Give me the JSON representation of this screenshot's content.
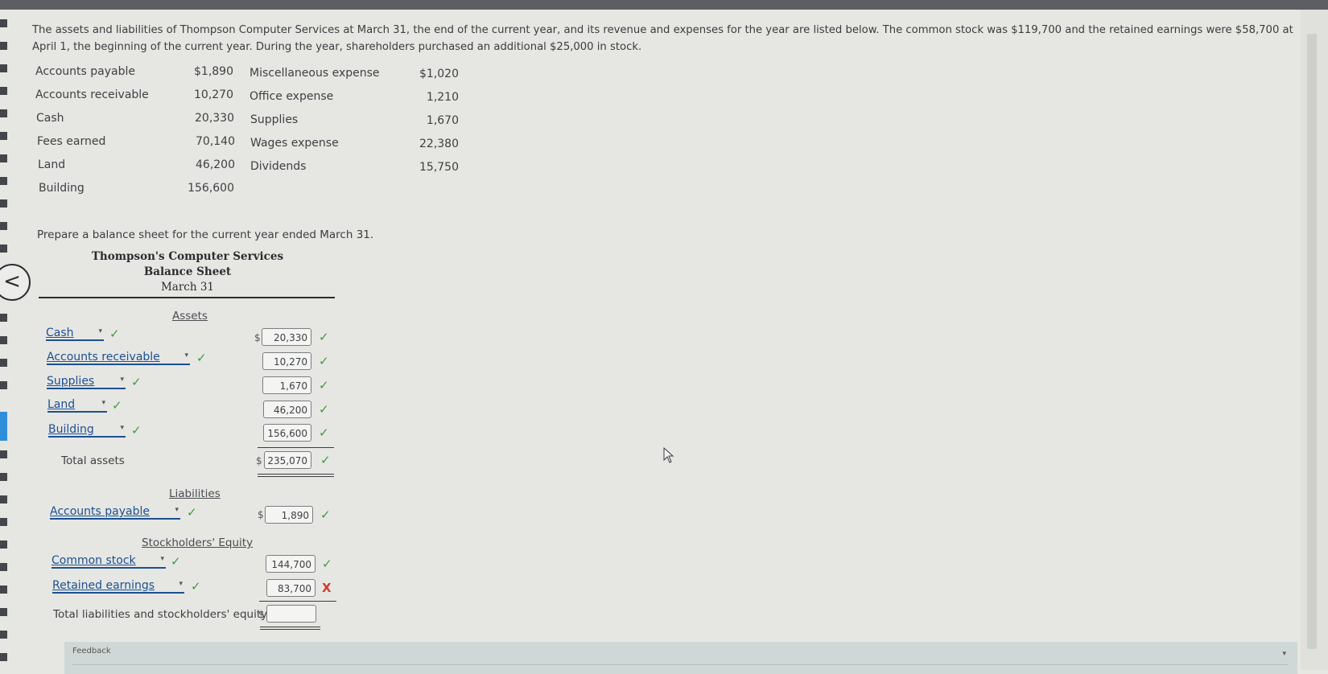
{
  "intro_text": "The assets and liabilities of Thompson Computer Services at March 31, the end of the current year, and its revenue and expenses for the year are listed below. The common stock was $119,700 and the retained earnings were $58,700 at April 1, the beginning of the current year. During the year, shareholders purchased an additional $25,000 in stock.",
  "data_list": {
    "left": [
      {
        "label": "Accounts payable",
        "value": "$1,890"
      },
      {
        "label": "Accounts receivable",
        "value": "10,270"
      },
      {
        "label": "Cash",
        "value": "20,330"
      },
      {
        "label": "Fees earned",
        "value": "70,140"
      },
      {
        "label": "Land",
        "value": "46,200"
      },
      {
        "label": "Building",
        "value": "156,600"
      }
    ],
    "right": [
      {
        "label": "Miscellaneous expense",
        "value": "$1,020"
      },
      {
        "label": "Office expense",
        "value": "1,210"
      },
      {
        "label": "Supplies",
        "value": "1,670"
      },
      {
        "label": "Wages expense",
        "value": "22,380"
      },
      {
        "label": "Dividends",
        "value": "15,750"
      }
    ]
  },
  "instruction": "Prepare a balance sheet for the current year ended March 31.",
  "header": {
    "company": "Thompson's Computer Services",
    "statement": "Balance Sheet",
    "date": "March 31"
  },
  "sections": {
    "assets": "Assets",
    "liabilities": "Liabilities",
    "equity": "Stockholders' Equity"
  },
  "assets": [
    {
      "account": "Cash",
      "amount": "20,330",
      "status": "correct"
    },
    {
      "account": "Accounts receivable",
      "amount": "10,270",
      "status": "correct"
    },
    {
      "account": "Supplies",
      "amount": "1,670",
      "status": "correct"
    },
    {
      "account": "Land",
      "amount": "46,200",
      "status": "correct"
    },
    {
      "account": "Building",
      "amount": "156,600",
      "status": "correct"
    }
  ],
  "total_assets": {
    "label": "Total assets",
    "amount": "235,070",
    "status": "correct"
  },
  "liabilities": [
    {
      "account": "Accounts payable",
      "amount": "1,890",
      "status": "correct"
    }
  ],
  "equity": [
    {
      "account": "Common stock",
      "amount": "144,700",
      "status": "correct"
    },
    {
      "account": "Retained earnings",
      "amount": "83,700",
      "status": "incorrect"
    }
  ],
  "total_le": {
    "label": "Total liabilities and stockholders' equity",
    "amount": ""
  },
  "symbols": {
    "dollar": "$",
    "check": "✓",
    "cross": "X",
    "back": "<",
    "dropdown": "▾"
  },
  "feedback_label": "Feedback",
  "colors": {
    "correct": "#3f9b3d",
    "incorrect": "#d23a2e",
    "link": "#1d4f91"
  }
}
